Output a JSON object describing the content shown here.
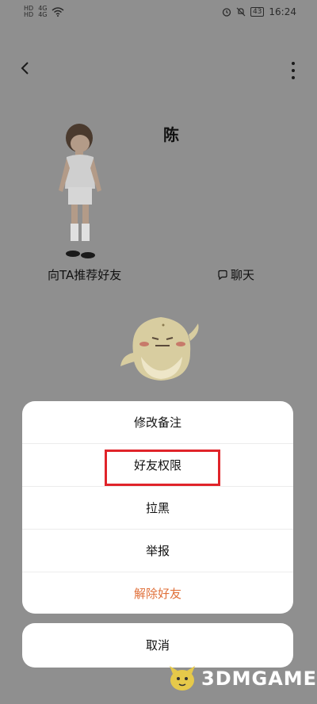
{
  "status_bar": {
    "sim1": "HD",
    "sim2": "HD",
    "net1": "4G",
    "net2": "4G",
    "battery": "43",
    "time": "16:24"
  },
  "profile": {
    "name": "陈",
    "recommend_label": "向TA推荐好友",
    "chat_label": "聊天"
  },
  "action_sheet": {
    "items": [
      {
        "label": "修改备注"
      },
      {
        "label": "好友权限"
      },
      {
        "label": "拉黑"
      },
      {
        "label": "举报"
      },
      {
        "label": "解除好友"
      }
    ],
    "cancel_label": "取消"
  },
  "watermark": {
    "text": "3DMGAME"
  },
  "colors": {
    "overlay": "#8f8f8f",
    "danger": "#e0703a",
    "highlight": "#e0242a"
  }
}
